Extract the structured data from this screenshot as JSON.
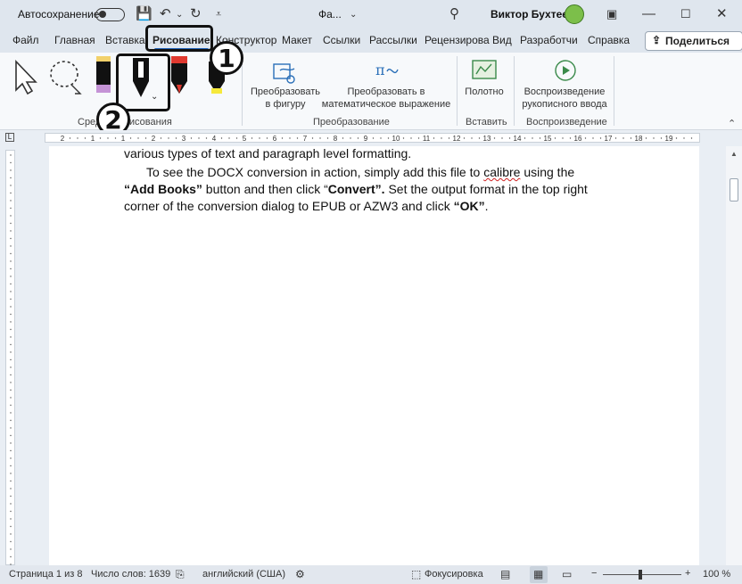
{
  "titlebar": {
    "autosave_label": "Автосохранение",
    "doc_name": "Фа...",
    "user_name": "Виктор Бухтеев"
  },
  "tabs": [
    {
      "label": "Файл"
    },
    {
      "label": "Главная"
    },
    {
      "label": "Вставка"
    },
    {
      "label": "Рисование"
    },
    {
      "label": "Конструктор"
    },
    {
      "label": "Макет"
    },
    {
      "label": "Ссылки"
    },
    {
      "label": "Рассылки"
    },
    {
      "label": "Рецензирова"
    },
    {
      "label": "Вид"
    },
    {
      "label": "Разработчи"
    },
    {
      "label": "Справка"
    }
  ],
  "share_label": "Поделиться",
  "ribbon": {
    "groups": [
      "Средства рисования",
      "Преобразование",
      "Вставить",
      "Воспроизведение"
    ],
    "buttons": {
      "convert_shape": [
        "Преобразовать",
        "в фигуру"
      ],
      "convert_math": [
        "Преобразовать в",
        "математическое выражение"
      ],
      "canvas": "Полотно",
      "replay": [
        "Воспроизведение",
        "рукописного ввода"
      ]
    }
  },
  "callouts": [
    "1",
    "2"
  ],
  "ruler_labels": [
    "2",
    "1",
    "1",
    "2",
    "3",
    "4",
    "5",
    "6",
    "7",
    "8",
    "9",
    "10",
    "11",
    "12",
    "13",
    "14",
    "15",
    "16",
    "17",
    "18",
    "19"
  ],
  "document": {
    "line1": "various types of text and paragraph level formatting.",
    "line2_a": "To see the DOCX conversion in action, simply add this file to ",
    "line2_b": "calibre",
    "line2_c": " using the",
    "line3_a": "“Add Books”",
    "line3_b": " button and then click “",
    "line3_c": "Convert”.",
    "line3_d": "  Set the output format in the top right",
    "line4_a": "corner of the conversion dialog to EPUB or AZW3 and click ",
    "line4_b": "“OK”",
    "line4_c": "."
  },
  "status": {
    "page": "Страница 1 из 8",
    "words": "Число слов: 1639",
    "language": "английский (США)",
    "focus": "Фокусировка",
    "zoom": "100 %"
  }
}
